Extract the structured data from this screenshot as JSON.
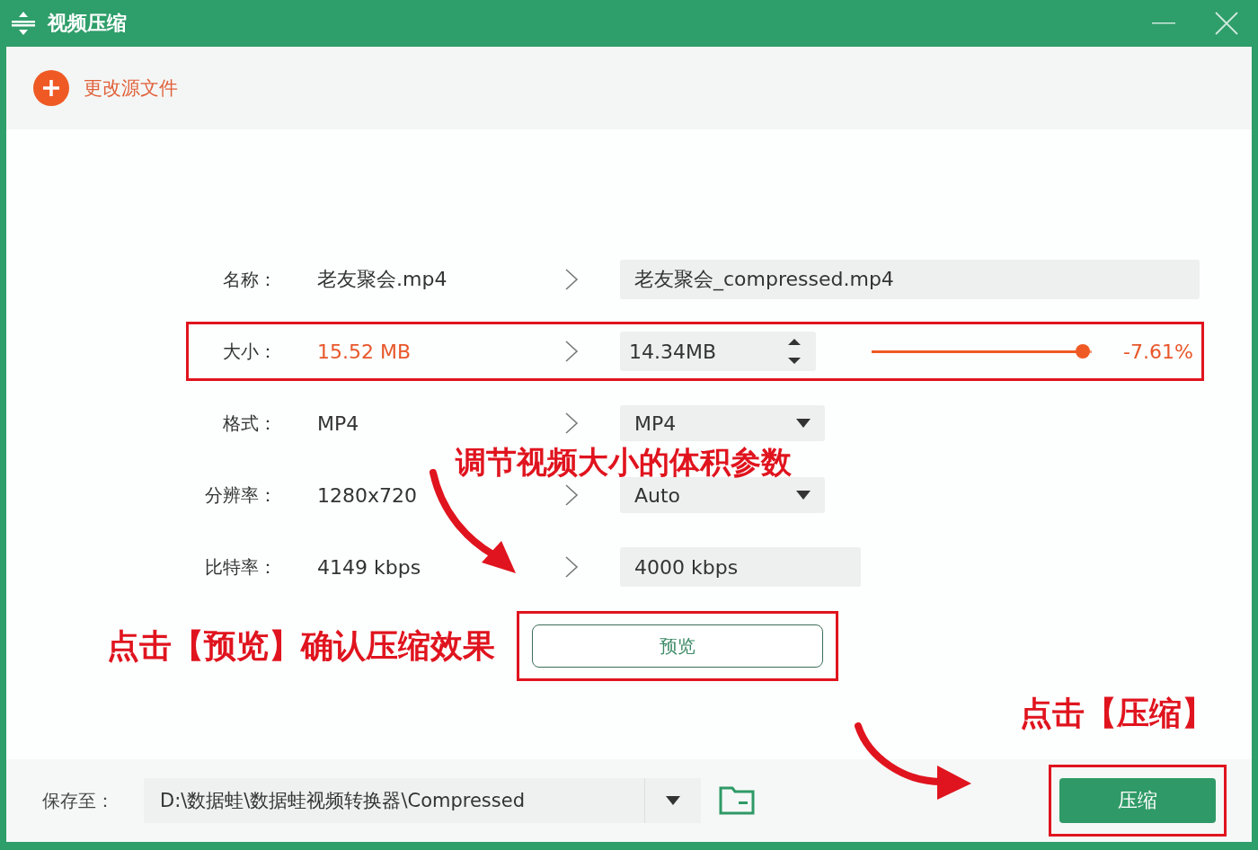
{
  "window": {
    "title": "视频压缩"
  },
  "toolbar": {
    "change_source": "更改源文件"
  },
  "rows": [
    {
      "kind": "text",
      "label": "名称：",
      "source": "老友聚会.mp4",
      "target": "老友聚会_compressed.mp4",
      "highlighted": false
    },
    {
      "kind": "size",
      "label": "大小：",
      "source": "15.52 MB",
      "target": "14.34MB",
      "level": 0.96,
      "reading": "-7.61%",
      "highlighted": true
    },
    {
      "kind": "select",
      "label": "格式：",
      "source": "MP4",
      "target": "MP4",
      "highlighted": false
    },
    {
      "kind": "select",
      "label": "分辨率：",
      "source": "1280x720",
      "target": "Auto",
      "highlighted": false
    },
    {
      "kind": "input",
      "label": "比特率：",
      "source": "4149 kbps",
      "target": "4000 kbps",
      "highlighted": false
    }
  ],
  "preview": {
    "label": "预览",
    "highlighted": true
  },
  "footer": {
    "label": "保存至：",
    "path": "D:\\数据蛙\\数据蛙视频转换器\\Compressed",
    "compress": "压缩",
    "highlighted": true
  },
  "annotations": [
    "调节视频大小的体积参数",
    "点击【预览】确认压缩效果",
    "点击【压缩】"
  ]
}
